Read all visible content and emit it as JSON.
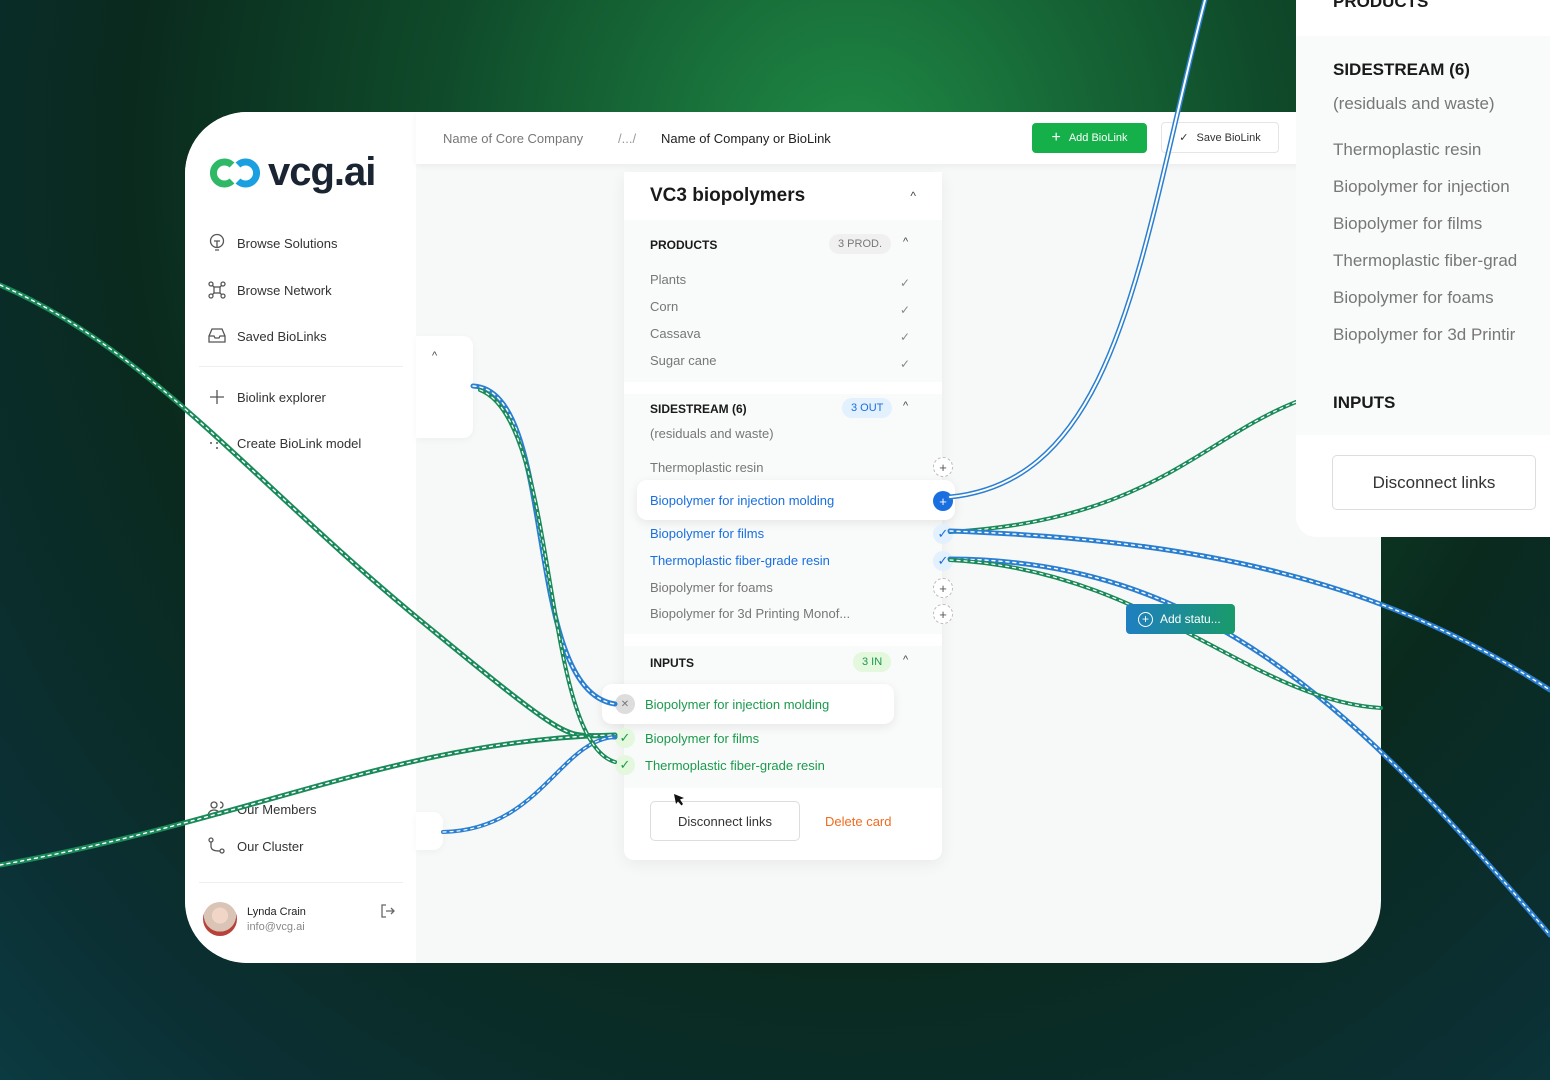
{
  "brand": {
    "name": "vcg.ai"
  },
  "sidebar": {
    "items": [
      {
        "label": "Browse Solutions",
        "icon": "lightbulb-icon"
      },
      {
        "label": "Browse Network",
        "icon": "network-icon"
      },
      {
        "label": "Saved BioLinks",
        "icon": "inbox-icon"
      },
      {
        "label": "Biolink explorer",
        "icon": "plus-icon"
      },
      {
        "label": "Create BioLink model",
        "icon": "model-icon"
      },
      {
        "label": "Our Members",
        "icon": "users-icon"
      },
      {
        "label": "Our Cluster",
        "icon": "cluster-icon"
      }
    ],
    "user": {
      "name": "Lynda Crain",
      "email": "info@vcg.ai"
    }
  },
  "header": {
    "breadcrumb": [
      "Name of Core Company",
      "/.../",
      "Name of Company or BioLink"
    ],
    "add_label": "Add BioLink",
    "save_label": "Save BioLink"
  },
  "card": {
    "title": "VC3 biopolymers",
    "products": {
      "title": "PRODUCTS",
      "badge": "3 PROD.",
      "items": [
        "Plants",
        "Corn",
        "Cassava",
        "Sugar cane"
      ]
    },
    "sidestream": {
      "title": "SIDESTREAM (6)",
      "subtitle": "(residuals and waste)",
      "badge": "3 OUT",
      "items": [
        {
          "label": "Thermoplastic resin",
          "state": "add"
        },
        {
          "label": "Biopolymer for injection molding",
          "state": "active"
        },
        {
          "label": "Biopolymer for films",
          "state": "linked"
        },
        {
          "label": "Thermoplastic fiber-grade resin",
          "state": "linked"
        },
        {
          "label": "Biopolymer for foams",
          "state": "add"
        },
        {
          "label": "Biopolymer for 3d Printing Monof...",
          "state": "add"
        }
      ]
    },
    "inputs": {
      "title": "INPUTS",
      "badge": "3 IN",
      "items": [
        "Biopolymer for injection molding",
        "Biopolymer for films",
        "Thermoplastic fiber-grade resin"
      ]
    },
    "disconnect_label": "Disconnect links",
    "delete_label": "Delete card"
  },
  "status_button": {
    "label": "Add statu..."
  },
  "right_panel": {
    "products_title": "PRODUCTS",
    "sidestream_title": "SIDESTREAM (6)",
    "subtitle": "(residuals and waste)",
    "items": [
      "Thermoplastic resin",
      "Biopolymer for injection",
      "Biopolymer for films",
      "Thermoplastic fiber-grad",
      "Biopolymer for foams",
      "Biopolymer for 3d Printir"
    ],
    "inputs_title": "INPUTS",
    "disconnect_label": "Disconnect links"
  },
  "colors": {
    "green": "#15b04a",
    "blue": "#1a6fe0",
    "link_green": "#1a8a5a",
    "link_blue": "#2b7fd0",
    "danger": "#f26b1d"
  }
}
